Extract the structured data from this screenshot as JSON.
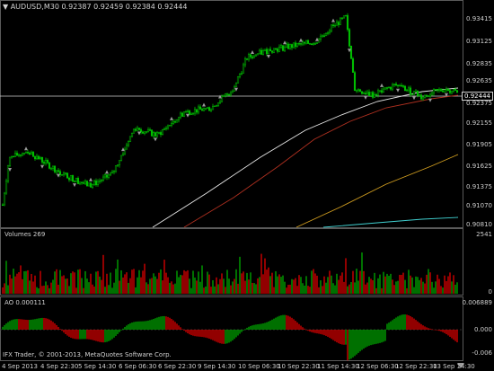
{
  "window": {
    "title": "AUDUSD,M30",
    "ohlc": [
      "0.92387",
      "0.92459",
      "0.92384",
      "0.92444"
    ],
    "copyright": "IFX Trader, © 2001-2013, MetaQuotes Software Corp."
  },
  "colors": {
    "background": "#000000",
    "bull_candle": "#00c000",
    "bear_candle": "#00c000",
    "fractal": "#9a9a9a",
    "ma_white": "#e8e8e8",
    "ma_red": "#b03020",
    "ma_orange": "#d4a020",
    "ma_cyan": "#40d0d0",
    "volume_up": "#00a000",
    "volume_down": "#d00000",
    "ao_up": "#00a000",
    "ao_down": "#d00000",
    "grid": "#3a3a3a"
  },
  "main": {
    "current_price": "0.92444",
    "y_ticks": [
      "0.93415",
      "0.93125",
      "0.92835",
      "0.92635",
      "0.92375",
      "0.92155",
      "0.91905",
      "0.91625",
      "0.91375",
      "0.91070",
      "0.90810"
    ]
  },
  "volume": {
    "title": "Volumes 269",
    "y_ticks": [
      "2541",
      "0"
    ]
  },
  "ao": {
    "title": "AO 0.000111",
    "y_ticks": [
      "0.006889",
      "0.000",
      "-0.006"
    ]
  },
  "x_axis": {
    "ticks": [
      "4 Sep 2013",
      "4 Sep 22:30",
      "5 Sep 14:30",
      "6 Sep 06:30",
      "6 Sep 22:30",
      "9 Sep 14:30",
      "10 Sep 06:30",
      "10 Sep 22:30",
      "11 Sep 14:30",
      "12 Sep 06:30",
      "12 Sep 22:30",
      "13 Sep 14:30"
    ]
  },
  "chart_data": {
    "type": "candlestick",
    "symbol": "AUDUSD",
    "timeframe": "M30",
    "x": [
      "4 Sep 2013",
      "4 Sep 22:30",
      "5 Sep 14:30",
      "6 Sep 06:30",
      "6 Sep 22:30",
      "9 Sep 14:30",
      "10 Sep 06:30",
      "10 Sep 22:30",
      "11 Sep 14:30",
      "12 Sep 06:30",
      "12 Sep 22:30",
      "13 Sep 14:30"
    ],
    "close_approx": [
      0.9085,
      0.916,
      0.9145,
      0.9195,
      0.9215,
      0.9265,
      0.9305,
      0.93,
      0.934,
      0.9245,
      0.925,
      0.9244
    ],
    "ylim": [
      0.9075,
      0.9355
    ],
    "volume_ylim": [
      0,
      2541
    ],
    "ao_ylim": [
      -0.006,
      0.006889
    ]
  }
}
